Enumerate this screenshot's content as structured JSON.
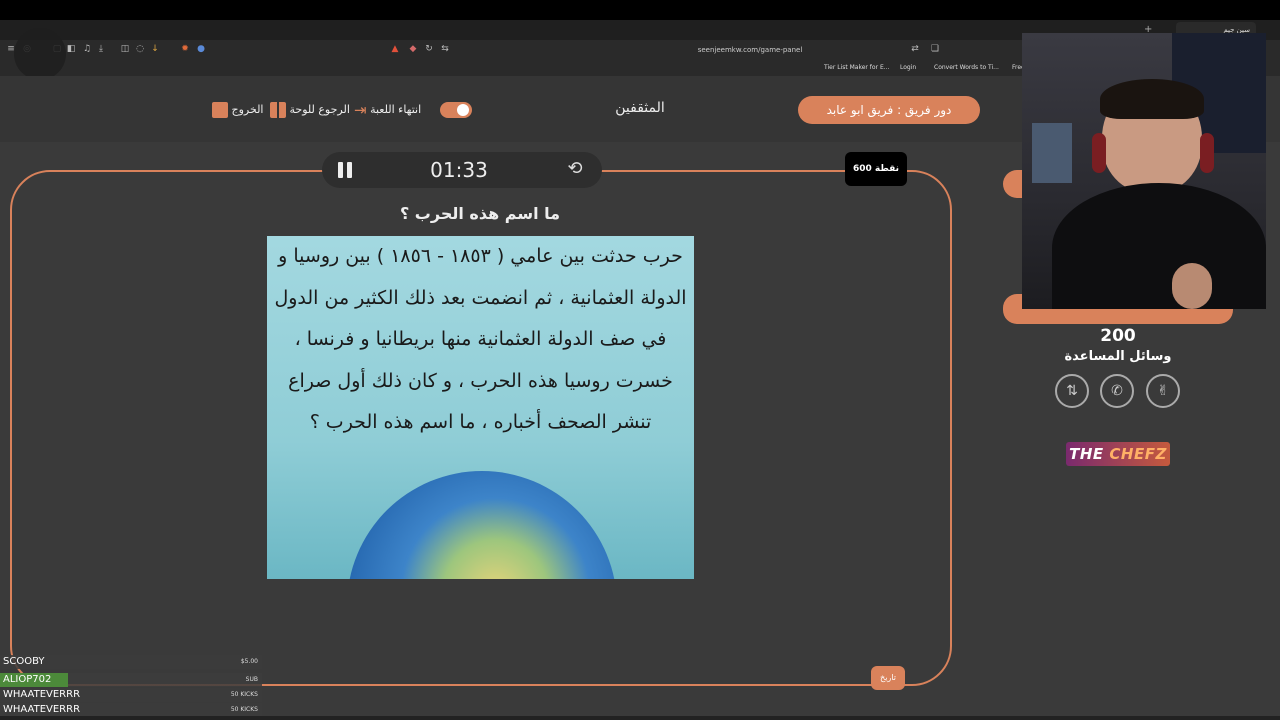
{
  "browser": {
    "tab_title": "سين جيم",
    "url": "seenjeemkw.com/game-panel",
    "bookmarks": [
      "Tier List Maker for E...",
      "Login",
      "Convert Words to Ti...",
      "Free"
    ]
  },
  "header": {
    "exit_label": "الخروج",
    "back_label": "الرجوع للوحة",
    "end_game_label": "انتهاء اللعبة",
    "team_name": "المثقفين",
    "turn_label": "دور فريق : فريق ابو عابد"
  },
  "question": {
    "timer": "01:33",
    "points_badge": "600 نقطة",
    "title": "ما اسم هذه الحرب ؟",
    "text": "حرب حدثت بين عامي ( ١٨٥٣ - ١٨٥٦ ) بين روسيا و الدولة العثمانية ، ثم انضمت بعد ذلك الكثير من الدول في صف الدولة العثمانية منها بريطانيا و فرنسا ، خسرت روسيا هذه الحرب ، و كان ذلك أول صراع تنشر الصحف أخباره ، ما اسم هذه الحرب ؟",
    "category_button": "تاريخ"
  },
  "right_panel": {
    "score": "200",
    "aids_label": "وسائل المساعدة",
    "aids_icons": [
      "swap-icon",
      "phone-icon",
      "two-fingers-icon"
    ],
    "logo_the": "THE",
    "logo_chefz": "CHEFZ"
  },
  "chat": [
    {
      "user": "SCOOBY",
      "amount": "$5.00"
    },
    {
      "user": "ALIOP702",
      "amount": "SUB"
    },
    {
      "user": "WHAATEVERRR",
      "amount": "50 KICKS"
    },
    {
      "user": "WHAATEVERRR",
      "amount": "50 KICKS"
    }
  ],
  "colors": {
    "accent": "#d9825b",
    "background": "#3a3a3a"
  }
}
